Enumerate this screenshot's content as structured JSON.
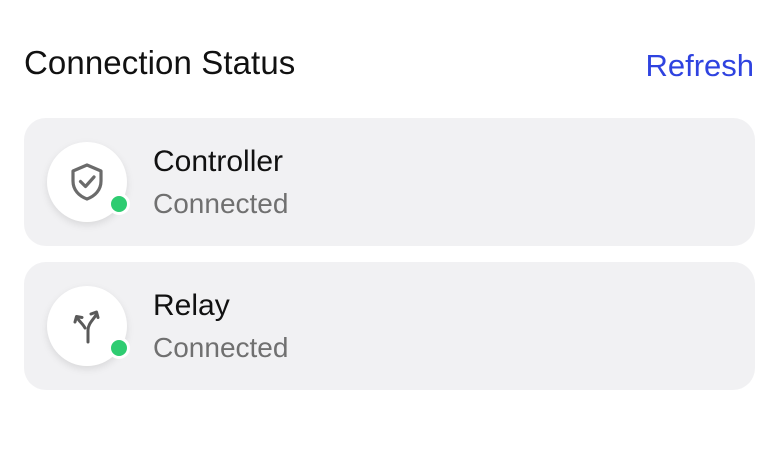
{
  "header": {
    "title": "Connection Status",
    "refresh_label": "Refresh"
  },
  "connections": [
    {
      "name": "Controller",
      "status": "Connected",
      "icon": "shield-check-icon",
      "status_color": "#2ecc71"
    },
    {
      "name": "Relay",
      "status": "Connected",
      "icon": "split-arrows-icon",
      "status_color": "#2ecc71"
    }
  ],
  "colors": {
    "accent": "#2f43e0",
    "card_bg": "#f1f1f3",
    "online": "#2ecc71"
  }
}
